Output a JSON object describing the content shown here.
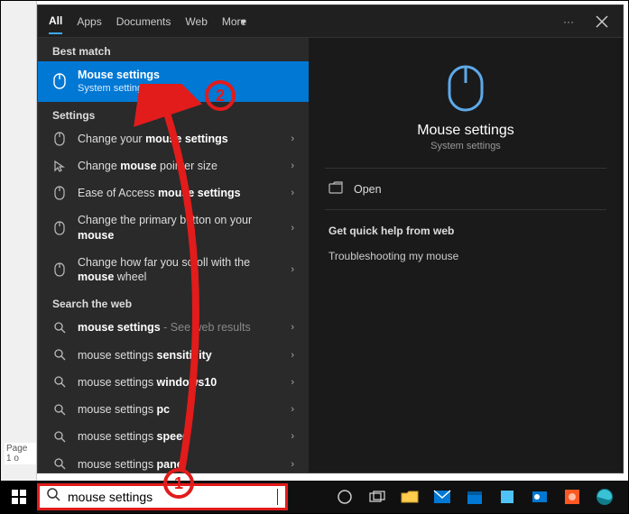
{
  "gutter": {
    "page_label": "Page 1 o"
  },
  "tabs": {
    "items": [
      "All",
      "Apps",
      "Documents",
      "Web",
      "More"
    ],
    "active_index": 0
  },
  "left": {
    "best_match_header": "Best match",
    "best_match": {
      "title": "Mouse settings",
      "subtitle": "System settings"
    },
    "settings_header": "Settings",
    "settings_items": [
      {
        "pre": "Change your ",
        "bold": "mouse settings",
        "post": ""
      },
      {
        "pre": "Change ",
        "bold": "mouse",
        "post": " pointer size"
      },
      {
        "pre": "Ease of Access ",
        "bold": "mouse settings",
        "post": ""
      },
      {
        "pre": "Change the primary button on your ",
        "bold": "mouse",
        "post": ""
      },
      {
        "pre": "Change how far you scroll with the ",
        "bold": "mouse",
        "post": " wheel"
      }
    ],
    "web_header": "Search the web",
    "web_items": [
      {
        "pre": "",
        "bold": "mouse settings",
        "post": "",
        "suffix": " - See web results"
      },
      {
        "pre": "mouse settings ",
        "bold": "sensitivity",
        "post": ""
      },
      {
        "pre": "mouse settings ",
        "bold": "windows10",
        "post": ""
      },
      {
        "pre": "mouse settings ",
        "bold": "pc",
        "post": ""
      },
      {
        "pre": "mouse settings ",
        "bold": "speed",
        "post": ""
      },
      {
        "pre": "mouse settings ",
        "bold": "panel",
        "post": ""
      }
    ]
  },
  "detail": {
    "title": "Mouse settings",
    "subtitle": "System settings",
    "open_label": "Open",
    "quick_header": "Get quick help from web",
    "quick_links": [
      "Troubleshooting my mouse"
    ]
  },
  "search": {
    "value": "mouse settings"
  },
  "annotations": {
    "one": "1",
    "two": "2"
  }
}
